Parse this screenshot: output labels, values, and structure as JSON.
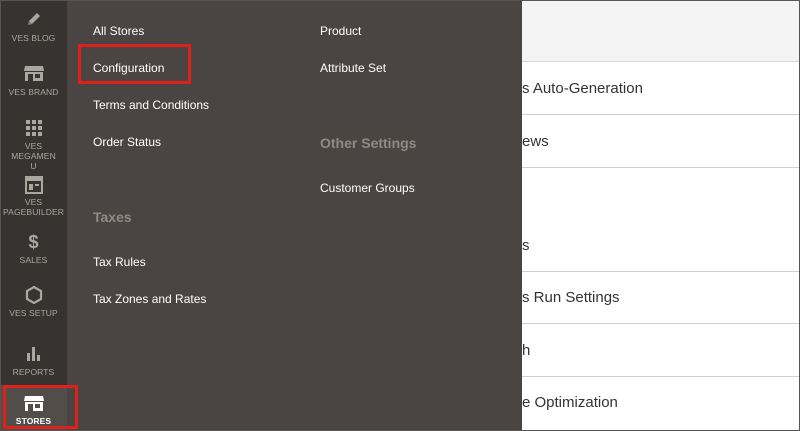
{
  "sidebar": {
    "items": [
      {
        "label": "VES BLOG",
        "icon": "pencil-icon"
      },
      {
        "label": "VES BRAND",
        "icon": "storefront-icon"
      },
      {
        "label": "VES MEGAMENU",
        "icon": "grid-icon"
      },
      {
        "label": "VES PAGEBUILDER",
        "icon": "layout-icon"
      },
      {
        "label": "SALES",
        "icon": "dollar-icon"
      },
      {
        "label": "VES SETUP",
        "icon": "hexagon-icon"
      },
      {
        "label": "REPORTS",
        "icon": "bar-chart-icon"
      },
      {
        "label": "STORES",
        "icon": "store-icon"
      }
    ]
  },
  "flyout": {
    "col1": {
      "all_stores": "All Stores",
      "configuration": "Configuration",
      "terms": "Terms and Conditions",
      "order_status": "Order Status",
      "taxes_heading": "Taxes",
      "tax_rules": "Tax Rules",
      "tax_zones": "Tax Zones and Rates"
    },
    "col2": {
      "product": "Product",
      "attribute_set": "Attribute Set",
      "other_heading": "Other Settings",
      "customer_groups": "Customer Groups"
    }
  },
  "content": {
    "rows": [
      "s Auto-Generation",
      "ews",
      "",
      "s",
      "s Run Settings",
      "h",
      "e Optimization"
    ]
  },
  "colors": {
    "nav_bg": "#373330",
    "flyout_bg": "#4a4542",
    "highlight": "#e0201b"
  }
}
